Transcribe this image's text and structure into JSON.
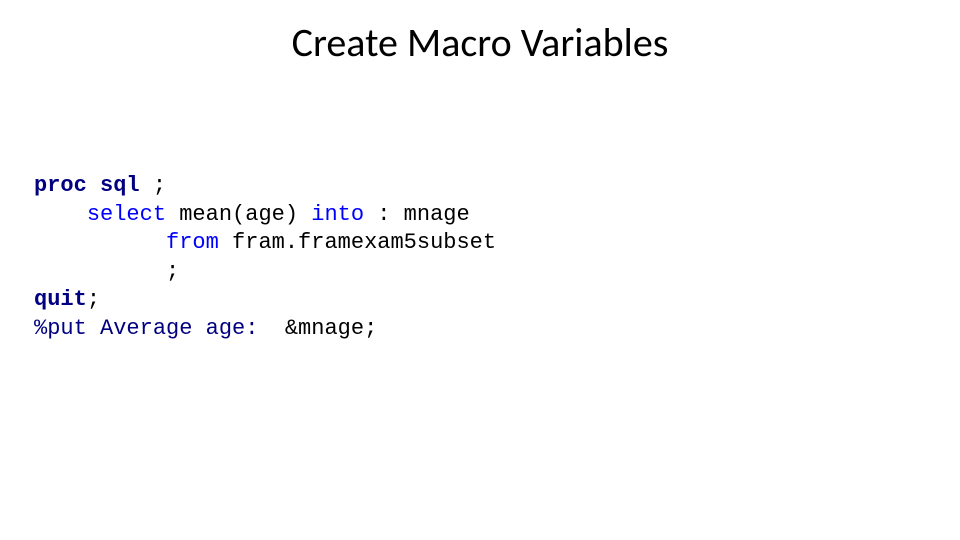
{
  "title": "Create Macro Variables",
  "code": {
    "l1_proc": "proc",
    "l1_sql": "sql",
    "l1_semi": " ;",
    "l2_indent": "    ",
    "l2_select": "select",
    "l2_mean": " mean(age) ",
    "l2_into": "into",
    "l2_mnage": " : mnage",
    "l3_indent": "          ",
    "l3_from": "from",
    "l3_dataset": " fram.framexam5subset",
    "l4_indent": "          ",
    "l4_semi": ";",
    "l5_quit": "quit",
    "l5_semi": ";",
    "l6_put": "%put",
    "l6_text": " Average age:  ",
    "l6_macro": "&mnage;"
  }
}
